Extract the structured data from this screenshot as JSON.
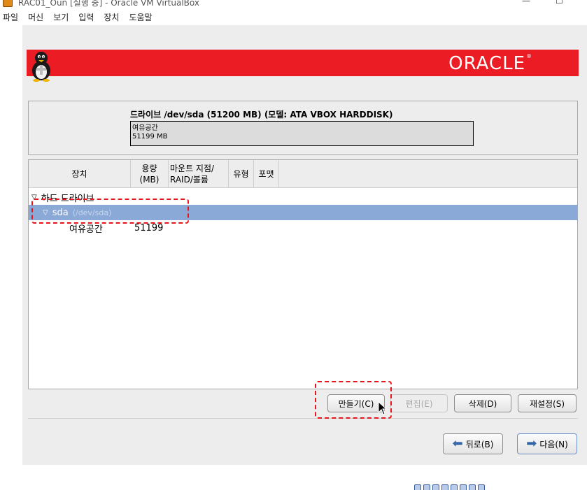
{
  "window": {
    "title": "RAC01_Oun [실행 중] - Oracle VM VirtualBox",
    "minimize_glyph": "—",
    "maximize_glyph": "☐"
  },
  "menu": [
    "파일",
    "머신",
    "보기",
    "입력",
    "장치",
    "도움말"
  ],
  "banner": {
    "logo_text": "ORACLE",
    "reg_mark": "®"
  },
  "drive": {
    "title": "드라이브 /dev/sda (51200 MB) (모델: ATA VBOX HARDDISK)",
    "free_label": "여유공간",
    "free_size": "51199 MB"
  },
  "table": {
    "columns": [
      "장치",
      "용량\n(MB)",
      "마운트 지점/\nRAID/볼륨",
      "유형",
      "포맷"
    ],
    "group_label": "하드 드라이브",
    "disk": {
      "name": "sda",
      "path": "(/dev/sda)"
    },
    "rows": [
      {
        "device": "여유공간",
        "size": "51199"
      }
    ]
  },
  "buttons": {
    "create": "만들기(C)",
    "edit": "편집(E)",
    "delete": "삭제(D)",
    "reset": "재설정(S)",
    "back": "뒤로(B)",
    "next": "다음(N)"
  },
  "colors": {
    "banner_red": "#ec1c24",
    "selection": "#8aa9d6",
    "annotation": "#e8141b"
  }
}
